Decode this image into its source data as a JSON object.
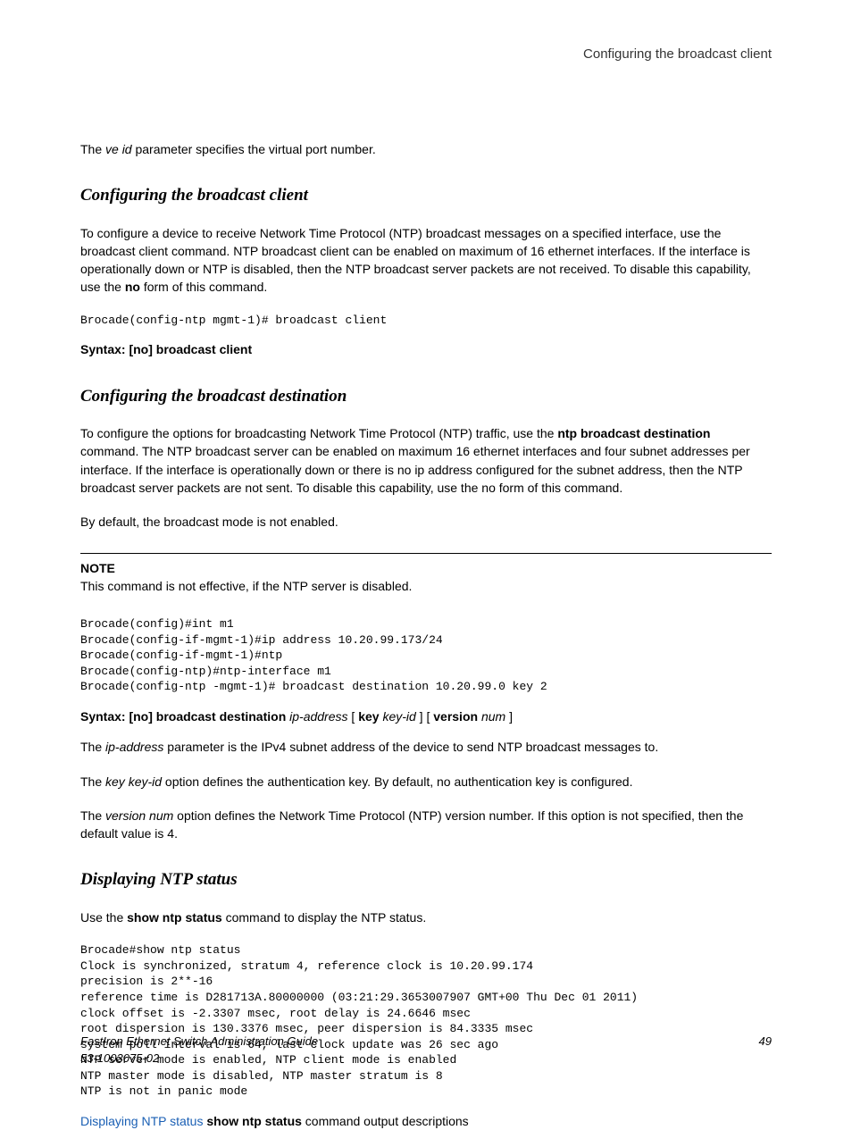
{
  "header": {
    "running_title": "Configuring the broadcast client"
  },
  "intro": {
    "line1_pre": "The ",
    "line1_em": "ve id",
    "line1_post": " parameter specifies the virtual port number."
  },
  "sec1": {
    "heading": "Configuring the broadcast client",
    "para": "To configure a device to receive Network Time Protocol (NTP) broadcast messages on a specified interface, use the broadcast client command. NTP broadcast client can be enabled on maximum of 16 ethernet interfaces. If the interface is operationally down or NTP is disabled, then the NTP broadcast server packets are not received. To disable this capability, use the ",
    "para_bold": "no",
    "para_after": " form of this command.",
    "code": "Brocade(config-ntp mgmt-1)# broadcast client",
    "syntax_label": "Syntax: [no] broadcast client"
  },
  "sec2": {
    "heading": "Configuring the broadcast destination",
    "para_pre": "To configure the options for broadcasting Network Time Protocol (NTP) traffic, use the ",
    "para_bold": "ntp broadcast destination",
    "para_post": " command. The NTP broadcast server can be enabled on maximum 16 ethernet interfaces and four subnet addresses per interface. If the interface is operationally down or there is no ip address configured for the subnet address, then the NTP broadcast server packets are not sent. To disable this capability, use the no form of this command.",
    "para2": "By default, the broadcast mode is not enabled.",
    "note_label": "NOTE",
    "note_body": "This command is not effective, if the NTP server is disabled.",
    "code": "Brocade(config)#int m1\nBrocade(config-if-mgmt-1)#ip address 10.20.99.173/24\nBrocade(config-if-mgmt-1)#ntp\nBrocade(config-ntp)#ntp-interface m1\nBrocade(config-ntp -mgmt-1)# broadcast destination 10.20.99.0 key 2",
    "syntax_seg1": "Syntax: [no] broadcast destination ",
    "syntax_em1": "ip-address",
    "syntax_seg2": " [ ",
    "syntax_bold2": "key",
    "syntax_seg25": " ",
    "syntax_em2": "key-id",
    "syntax_seg3": " ] [ ",
    "syntax_bold3": "version",
    "syntax_seg35": " ",
    "syntax_em3": "num",
    "syntax_seg4": " ]",
    "p3_pre": "The ",
    "p3_em": "ip-address",
    "p3_post": " parameter is the IPv4 subnet address of the device to send NTP broadcast messages to.",
    "p4_pre": "The ",
    "p4_em": "key key-id",
    "p4_post": " option defines the authentication key. By default, no authentication key is configured.",
    "p5_pre": "The ",
    "p5_em": "version num",
    "p5_post": " option defines the Network Time Protocol (NTP) version number. If this option is not specified, then the default value is 4."
  },
  "sec3": {
    "heading": "Displaying NTP status",
    "para_pre": "Use the ",
    "para_bold": "show ntp status",
    "para_post": " command to display the NTP status.",
    "code": "Brocade#show ntp status\nClock is synchronized, stratum 4, reference clock is 10.20.99.174\nprecision is 2**-16\nreference time is D281713A.80000000 (03:21:29.3653007907 GMT+00 Thu Dec 01 2011)\nclock offset is -2.3307 msec, root delay is 24.6646 msec\nroot dispersion is 130.3376 msec, peer dispersion is 84.3335 msec\nsystem poll interval is 64, last clock update was 26 sec ago\nNTP server mode is enabled, NTP client mode is enabled\nNTP master mode is disabled, NTP master stratum is 8\nNTP is not in panic mode",
    "link": "Displaying NTP status",
    "link_bold": " show ntp status",
    "link_post": " command output descriptions"
  },
  "footer": {
    "title": "FastIron Ethernet Switch Administration Guide",
    "docnum": "53-1003075-02",
    "page": "49"
  }
}
